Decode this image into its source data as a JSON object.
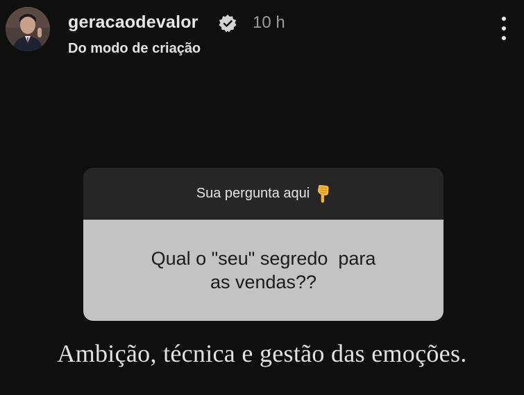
{
  "header": {
    "username": "geracaodevalor",
    "verified_icon": "verified-badge-icon",
    "timestamp": "10 h",
    "subtitle": "Do modo de criação",
    "more_icon": "more-vertical-icon"
  },
  "sticker": {
    "prompt": "Sua pergunta aqui",
    "prompt_emoji_icon": "pointing-down-hand-icon",
    "question_lines": [
      "Qual o \"seu\" segredo  para",
      "as vendas??"
    ]
  },
  "caption": "Ambição, técnica e gestão das emoções.",
  "colors": {
    "background": "#0f0f0f",
    "sticker_header": "#262626",
    "sticker_body": "#c3c3c3",
    "emoji": "#f2b43a"
  }
}
